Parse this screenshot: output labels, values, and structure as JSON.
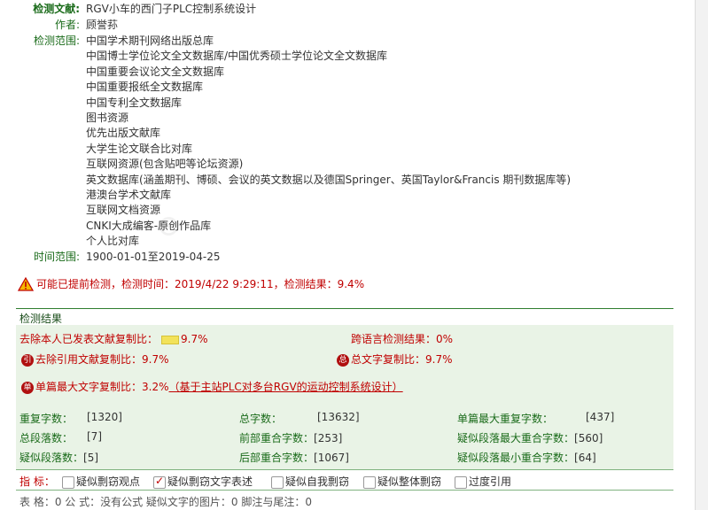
{
  "meta": {
    "doc_label": "检测文献:",
    "doc_title": "RGV小车的西门子PLC控制系统设计",
    "author_label": "作者:",
    "author": "顾誉荪",
    "scope_label": "检测范围:",
    "scope": [
      "中国学术期刊网络出版总库",
      "中国博士学位论文全文数据库/中国优秀硕士学位论文全文数据库",
      "中国重要会议论文全文数据库",
      "中国重要报纸全文数据库",
      "中国专利全文数据库",
      "图书资源",
      "优先出版文献库",
      "大学生论文联合比对库",
      "互联网资源(包含贴吧等论坛资源)",
      "英文数据库(涵盖期刊、博硕、会议的英文数据以及德国Springer、英国Taylor&Francis 期刊数据库等)",
      "港澳台学术文献库",
      "互联网文档资源",
      "CNKI大成编客-原创作品库",
      "个人比对库"
    ],
    "time_label": "时间范围:",
    "time_range": "1900-01-01至2019-04-25"
  },
  "warning": "可能已提前检测，检测时间：2019/4/22 9:29:11，检测结果：9.4%",
  "result": {
    "header": "检测结果",
    "self_excl_label": "去除本人已发表文献复制比：",
    "self_excl_value": "9.7%",
    "cross_lang": "跨语言检测结果：0%",
    "cite_icon": "引",
    "cite_excl": "去除引用文献复制比：9.7%",
    "total_icon": "总",
    "total_copy": "总文字复制比：9.7%",
    "single_icon": "单",
    "single_label": "单篇最大文字复制比：3.2%",
    "single_link": "（基于主站PLC对多台RGV的运动控制系统设计）",
    "stats": {
      "dup_chars_k": "重复字数：",
      "dup_chars_v": "[1320]",
      "total_chars_k": "总字数：",
      "total_chars_v": "[13632]",
      "single_max_dup_k": "单篇最大重复字数：",
      "single_max_dup_v": "[437]",
      "para_count_k": "总段落数：",
      "para_count_v": "[7]",
      "front_overlap_k": "前部重合字数：",
      "front_overlap_v": "[253]",
      "max_para_overlap_k": "疑似段落最大重合字数：",
      "max_para_overlap_v": "[560]",
      "sus_para_k": "疑似段落数：",
      "sus_para_v": "[5]",
      "back_overlap_k": "后部重合字数：",
      "back_overlap_v": "[1067]",
      "min_para_overlap_k": "疑似段落最小重合字数：",
      "min_para_overlap_v": "[64]"
    },
    "indicators_label": "指  标：",
    "indicators": [
      {
        "label": "疑似剽窃观点",
        "checked": false
      },
      {
        "label": "疑似剽窃文字表述",
        "checked": true
      },
      {
        "label": "疑似自我剽窃",
        "checked": false
      },
      {
        "label": "疑似整体剽窃",
        "checked": false
      },
      {
        "label": "过度引用",
        "checked": false
      }
    ],
    "footer": "表 格：0    公 式：没有公式    疑似文字的图片：0    脚注与尾注：0"
  },
  "colors": {
    "accent_green": "#1a6b1a",
    "alert_red": "#c00000",
    "panel_bg": "#e9f3e6"
  }
}
